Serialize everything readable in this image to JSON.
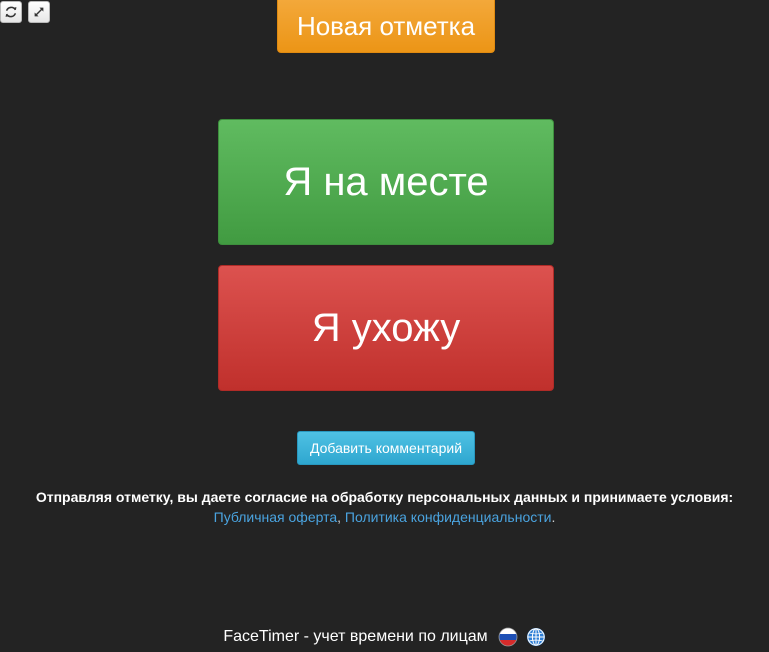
{
  "toolbar": {
    "refresh_icon": "refresh-icon",
    "expand_icon": "expand-icon"
  },
  "header": {
    "new_mark_label": "Новая отметка"
  },
  "actions": {
    "here_label": "Я на месте",
    "leave_label": "Я ухожу",
    "comment_label": "Добавить комментарий"
  },
  "consent": {
    "text": "Отправляя отметку, вы даете согласие на обработку персональных данных и принимаете условия:",
    "offer_link": "Публичная оферта",
    "separator": ",",
    "privacy_link": "Политика конфиденциальности",
    "end": "."
  },
  "footer": {
    "brand_text": "FaceTimer - учет времени по лицам",
    "flag_icon": "russian-flag-icon",
    "globe_icon": "globe-icon"
  },
  "colors": {
    "background": "#232323",
    "orange": "#ee9a1f",
    "green": "#4cae4c",
    "red": "#d43f3a",
    "blue": "#39b3d7",
    "link": "#4aa3df"
  }
}
